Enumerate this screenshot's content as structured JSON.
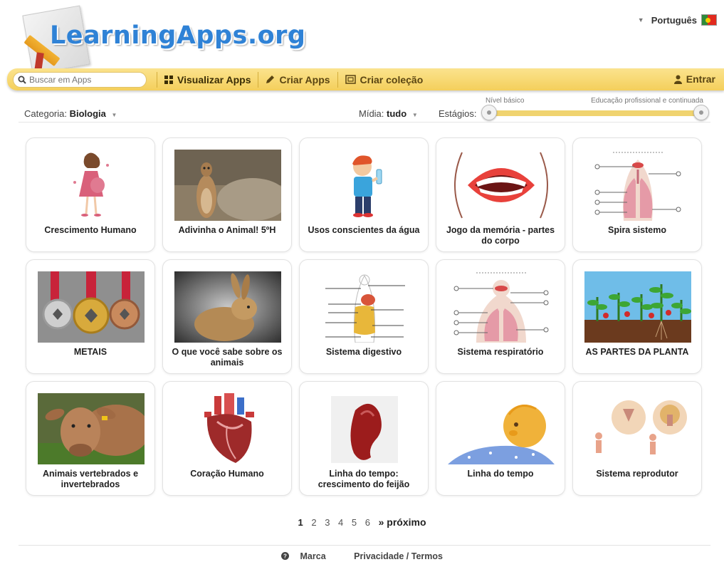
{
  "logo": {
    "text": "LearningApps.org"
  },
  "language": {
    "label": "Português"
  },
  "nav": {
    "search_placeholder": "Buscar em Apps",
    "view_apps": "Visualizar Apps",
    "create_apps": "Criar Apps",
    "create_collection": "Criar coleção",
    "login": "Entrar"
  },
  "filters": {
    "category_label": "Categoria:",
    "category_value": "Biologia",
    "media_label": "Mídia:",
    "media_value": "tudo",
    "stages_label": "Estágios:",
    "stage_min": "Nível básico",
    "stage_max": "Educação profissional e continuada"
  },
  "apps": [
    {
      "title": "Crescimento Humano",
      "thumb": "pregnant-woman-image"
    },
    {
      "title": "Adivinha o Animal! 5ºH",
      "thumb": "meerkat-photo"
    },
    {
      "title": "Usos conscientes da água",
      "thumb": "boy-with-water-bottle-image"
    },
    {
      "title": "Jogo da memória - partes do corpo",
      "thumb": "mouth-image"
    },
    {
      "title": "Spira sistemo",
      "thumb": "lungs-diagram-image"
    },
    {
      "title": "METAIS",
      "thumb": "medals-photo"
    },
    {
      "title": "O que você sabe sobre os animais",
      "thumb": "rabbit-photo"
    },
    {
      "title": "Sistema digestivo",
      "thumb": "digestive-system-diagram"
    },
    {
      "title": "Sistema respiratório",
      "thumb": "respiratory-system-diagram"
    },
    {
      "title": "AS PARTES DA PLANTA",
      "thumb": "plants-photo"
    },
    {
      "title": "Animais vertebrados e invertebrados",
      "thumb": "cow-photo"
    },
    {
      "title": "Coração Humano",
      "thumb": "heart-image"
    },
    {
      "title": "Linha do tempo: crescimento do feijão",
      "thumb": "bean-image"
    },
    {
      "title": "Linha do tempo",
      "thumb": "baby-image"
    },
    {
      "title": "Sistema reprodutor",
      "thumb": "reproductive-system-image"
    }
  ],
  "pagination": {
    "pages": [
      "1",
      "2",
      "3",
      "4",
      "5",
      "6"
    ],
    "current": "1",
    "next": "» próximo"
  },
  "footer": {
    "brand": "Marca",
    "privacy": "Privacidade / Termos"
  },
  "colors": {
    "navbar": "#f4cf5b",
    "logo_blue": "#2f82d6",
    "slider": "#f0d36f"
  }
}
